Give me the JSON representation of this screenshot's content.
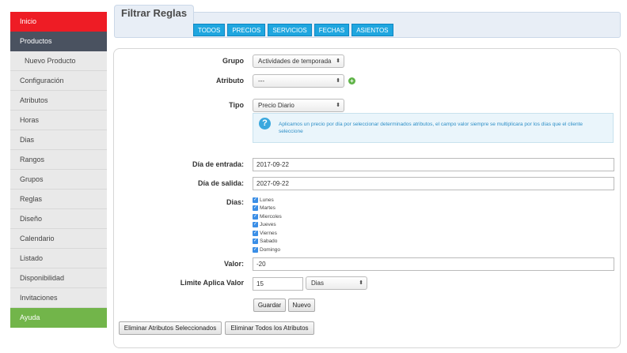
{
  "sidebar": {
    "items": [
      {
        "label": "Inicio",
        "style": "red"
      },
      {
        "label": "Productos",
        "style": "dark"
      },
      {
        "label": "Nuevo Producto",
        "style": "sub"
      },
      {
        "label": "Configuración",
        "style": "normal"
      },
      {
        "label": "Atributos",
        "style": "normal"
      },
      {
        "label": "Horas",
        "style": "normal"
      },
      {
        "label": "Dias",
        "style": "normal"
      },
      {
        "label": "Rangos",
        "style": "normal"
      },
      {
        "label": "Grupos",
        "style": "normal"
      },
      {
        "label": "Reglas",
        "style": "normal"
      },
      {
        "label": "Diseño",
        "style": "normal"
      },
      {
        "label": "Calendario",
        "style": "normal"
      },
      {
        "label": "Listado",
        "style": "normal"
      },
      {
        "label": "Disponibilidad",
        "style": "normal"
      },
      {
        "label": "Invitaciones",
        "style": "normal"
      },
      {
        "label": "Ayuda",
        "style": "green"
      }
    ]
  },
  "filter": {
    "title": "Filtrar Reglas",
    "buttons": [
      "TODOS",
      "PRECIOS",
      "SERVICIOS",
      "FECHAS",
      "ASIENTOS"
    ]
  },
  "form": {
    "grupo_label": "Grupo",
    "grupo_value": "Actividades de temporada",
    "atributo_label": "Atributo",
    "atributo_value": "---",
    "tipo_label": "Tipo",
    "tipo_value": "Precio Diario",
    "info_text": "Aplicamos un precio por día por seleccionar determinados atributos, el campo valor siempre se multiplicara por los días que el cliente seleccione",
    "entrada_label": "Día de entrada:",
    "entrada_value": "2017-09-22",
    "salida_label": "Día de salida:",
    "salida_value": "2027-09-22",
    "dias_label": "Dias:",
    "dias": [
      "Lunes",
      "Martes",
      "Miercoles",
      "Jueves",
      "Viernes",
      "Sabado",
      "Domingo"
    ],
    "valor_label": "Valor:",
    "valor_value": "-20",
    "limite_label": "Limite Aplica Valor",
    "limite_value": "15",
    "limite_unit": "Dias",
    "guardar_label": "Guardar",
    "nuevo_label": "Nuevo"
  },
  "bottom": {
    "eliminar_sel_label": "Eliminar Atributos Seleccionados",
    "eliminar_todos_label": "Eliminar Todos los Atributos"
  },
  "colors": {
    "accent_red": "#ee1c25",
    "sidebar_dark": "#4a5260",
    "help_green": "#72b54a",
    "filter_blue": "#1fa6df"
  }
}
